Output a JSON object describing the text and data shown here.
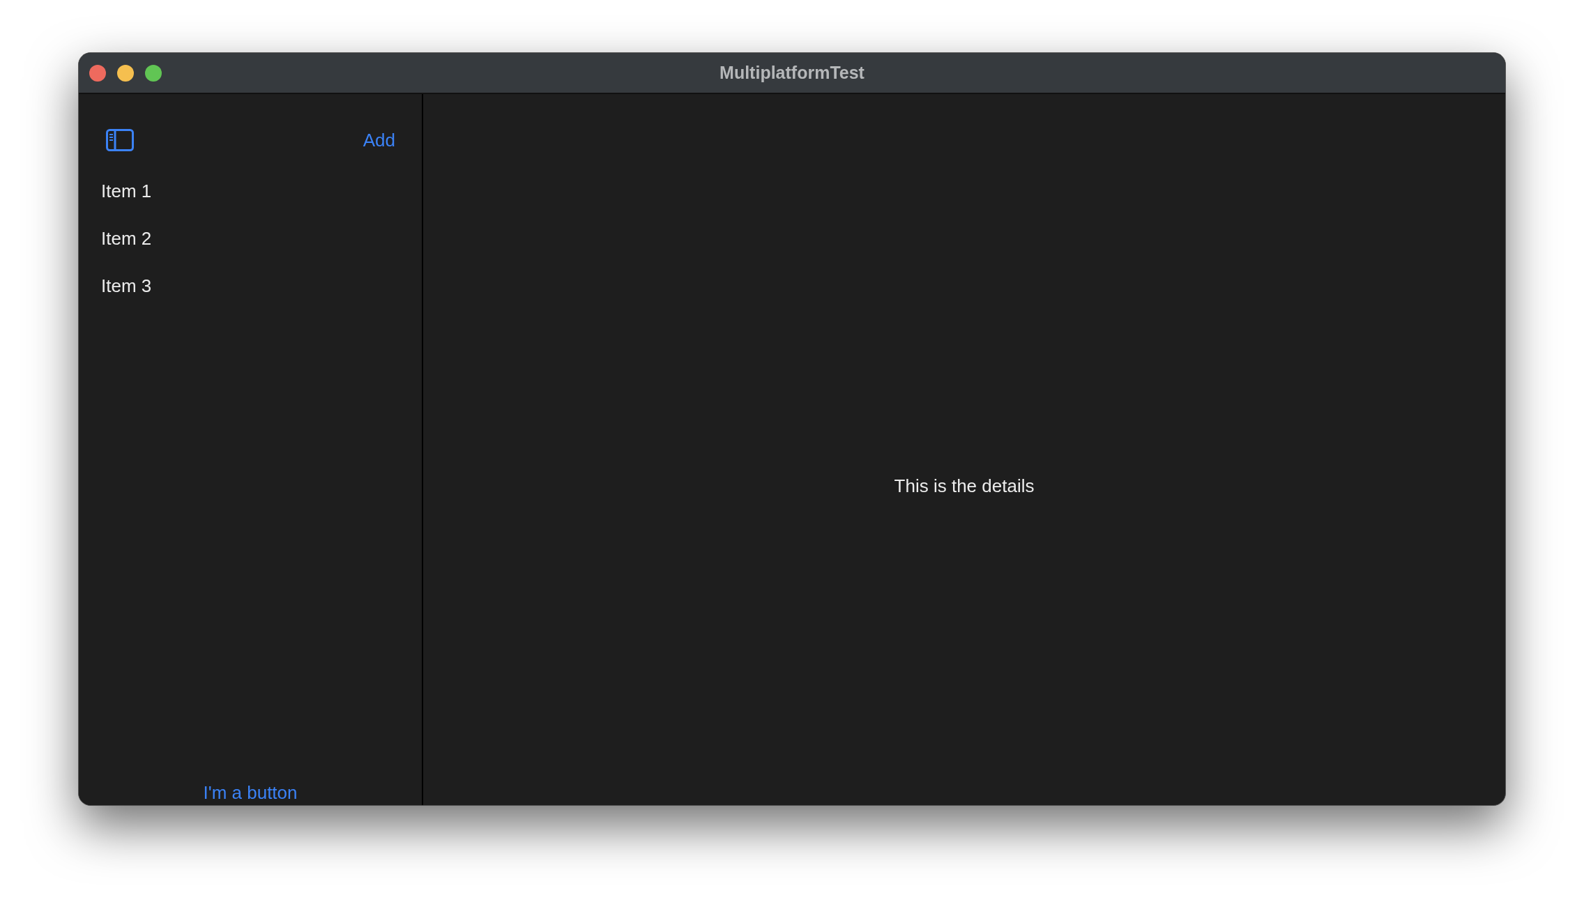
{
  "window": {
    "title": "MultiplatformTest"
  },
  "sidebar": {
    "add_button": "Add",
    "items": [
      {
        "label": "Item 1"
      },
      {
        "label": "Item 2"
      },
      {
        "label": "Item 3"
      }
    ],
    "footer_button": "I'm a button"
  },
  "detail": {
    "text": "This is the details"
  }
}
